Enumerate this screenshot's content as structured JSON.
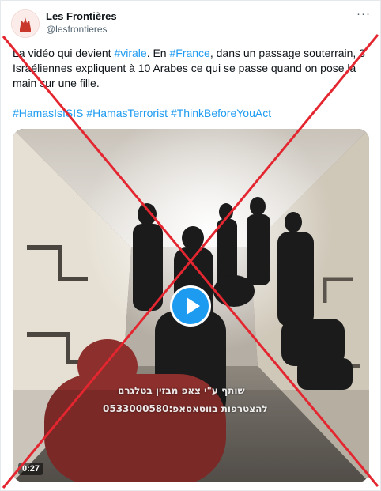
{
  "account": {
    "display_name": "Les Frontières",
    "handle": "@lesfrontieres"
  },
  "menu": {
    "more_label": "···"
  },
  "tweet": {
    "line1": [
      {
        "t": "La vidéo qui devient ",
        "link": false
      },
      {
        "t": "#virale",
        "link": true
      },
      {
        "t": ".  En ",
        "link": false
      },
      {
        "t": "#France",
        "link": true
      },
      {
        "t": ", dans un passage souterrain, 3 Israéliennes expliquent à 10 Arabes ce qui se passe quand on pose la main sur une fille.",
        "link": false
      }
    ],
    "hashtags": [
      "#HamasIsISIS",
      "#HamasTerrorist",
      "#ThinkBeforeYouAct"
    ]
  },
  "video": {
    "duration": "0:27",
    "caption_line1": "שותף ע\"י צאפ מבזין בטלגרם",
    "caption_line2": "להצטרפות בווטאסאפ:0533000580"
  },
  "colors": {
    "link": "#1d9bf0",
    "play_button": "#1d9bf0",
    "cross": "#e3262f",
    "text": "#0f1419",
    "muted": "#536471"
  },
  "icons": {
    "avatar": "les-frontieres-logo",
    "play": "play-icon",
    "more": "more-dots-icon"
  }
}
